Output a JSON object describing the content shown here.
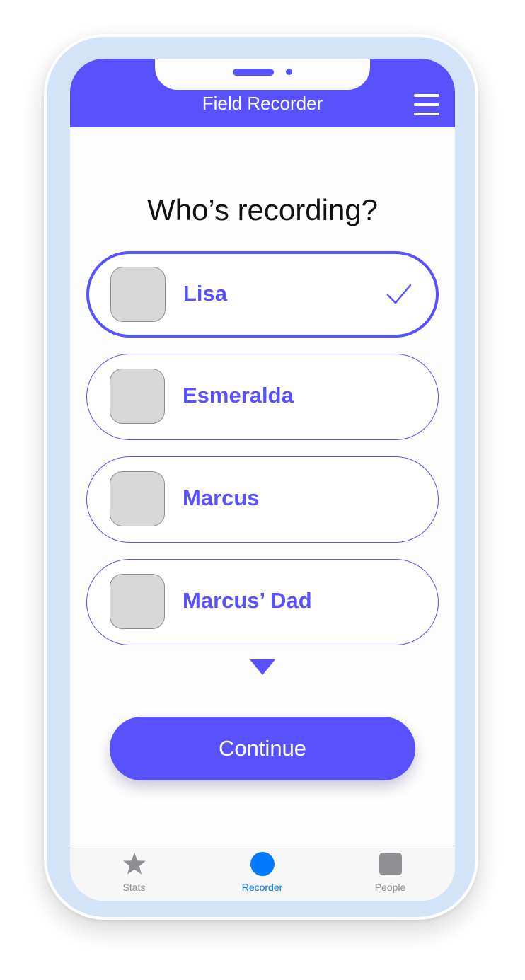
{
  "header": {
    "title": "Field Recorder",
    "menu_icon": "hamburger-menu-icon"
  },
  "main": {
    "heading": "Who’s recording?",
    "people": [
      {
        "name": "Lisa",
        "selected": true
      },
      {
        "name": "Esmeralda",
        "selected": false
      },
      {
        "name": "Marcus",
        "selected": false
      },
      {
        "name": "Marcus’ Dad",
        "selected": false
      }
    ],
    "selected_icon": "checkmark-icon",
    "more_icon": "triangle-down-icon",
    "continue_label": "Continue"
  },
  "tabbar": {
    "tabs": [
      {
        "label": "Stats",
        "icon": "star-icon",
        "active": false
      },
      {
        "label": "Recorder",
        "icon": "circle-icon",
        "active": true
      },
      {
        "label": "People",
        "icon": "square-icon",
        "active": false
      }
    ]
  },
  "colors": {
    "accent": "#5851fe",
    "frame": "#d4e4f8",
    "tab_active": "#007aff",
    "tab_inactive": "#8e8e93",
    "avatar_placeholder": "#d8d8d8"
  }
}
